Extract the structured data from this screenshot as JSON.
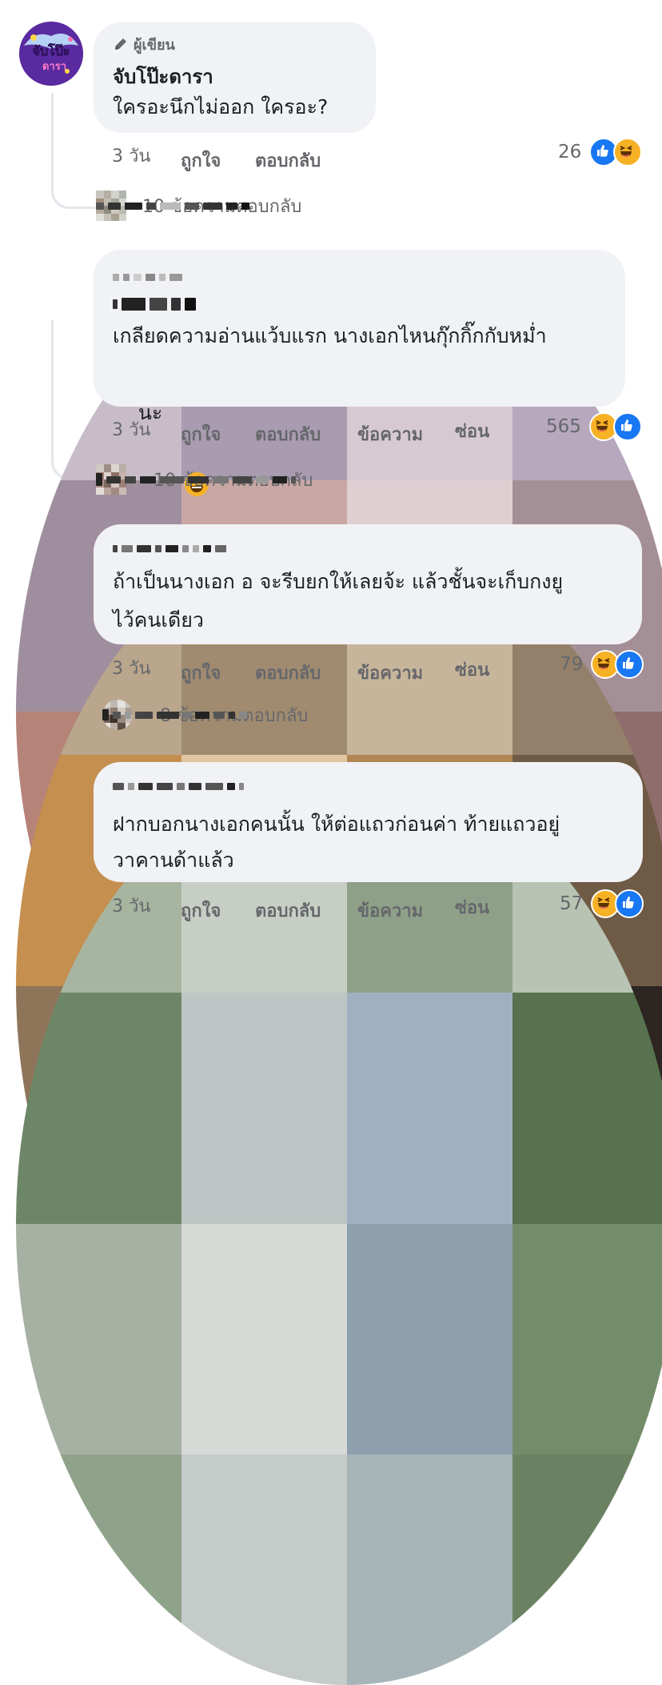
{
  "comments": [
    {
      "badge": "ผู้เขียน",
      "author": "จับโป๊ะดารา",
      "avatar_text_top": "จับโป๊ะ",
      "avatar_text_bottom": "ดารา",
      "lines": [
        "ใครอะนึกไม่ออก ใครอะ?"
      ],
      "time": "3 วัน",
      "like_label": "ถูกใจ",
      "reply_label": "ตอบกลับ",
      "reaction_count": "26",
      "reactions": [
        "like",
        "haha"
      ],
      "replies_label": "10 ข้อความตอบกลับ"
    },
    {
      "lines": [
        "เกลียดความอ่านแว้บแรก นางเอกไหนกุ๊กกิ๊กกับหม่ำ",
        "นะ"
      ],
      "time": "3 วัน",
      "like_label": "ถูกใจ",
      "reply_label": "ตอบกลับ",
      "message_label": "ข้อความ",
      "hide_label": "ซ่อน",
      "reaction_count": "565",
      "reactions": [
        "haha",
        "like"
      ],
      "replies_label": "· 10 ข้อความตอบกลับ"
    },
    {
      "lines": [
        "ถ้าเป็นนางเอก อ จะรีบยกให้เลยจ้ะ แล้วชั้นจะเก็บกงยู",
        "ไว้คนเดียว"
      ],
      "time": "3 วัน",
      "like_label": "ถูกใจ",
      "reply_label": "ตอบกลับ",
      "message_label": "ข้อความ",
      "hide_label": "ซ่อน",
      "reaction_count": "79",
      "reactions": [
        "haha",
        "like"
      ],
      "replies_label": "· 8 ข้อความตอบกลับ"
    },
    {
      "lines": [
        "ฝากบอกนางเอกคนนั้น ให้ต่อแถวก่อนค่า ท้ายแถวอยู่",
        "วาคานด้าแล้ว"
      ],
      "time": "3 วัน",
      "like_label": "ถูกใจ",
      "reply_label": "ตอบกลับ",
      "message_label": "ข้อความ",
      "hide_label": "ซ่อน",
      "reaction_count": "57",
      "reactions": [
        "haha",
        "like"
      ]
    }
  ],
  "colors": {
    "bubble": "#f0f2f5",
    "like": "#1877f2",
    "haha": "#f7b125",
    "meta_text": "#65676b"
  }
}
